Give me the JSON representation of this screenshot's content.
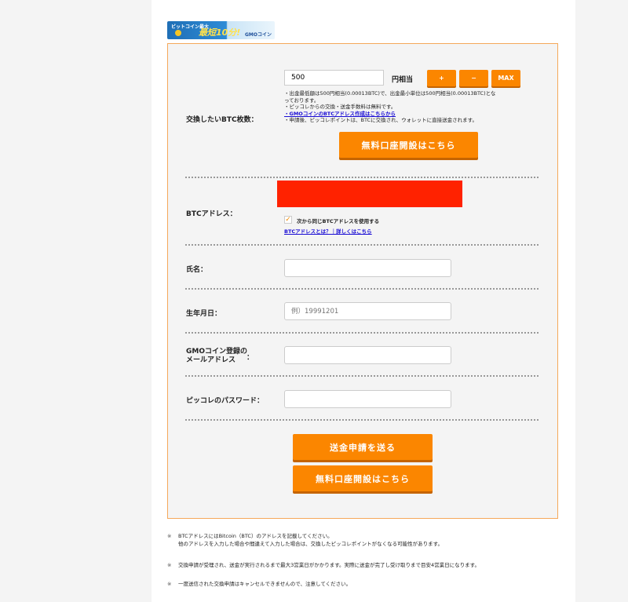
{
  "banner": {
    "line1": "ビットコイン最大",
    "main": "最短10分!",
    "brand": "GMOコイン"
  },
  "form": {
    "btc_amount": {
      "label": "交換したいBTC枚数：",
      "value": "500",
      "unit": "円相当",
      "plus": "+",
      "minus": "−",
      "max": "MAX",
      "notes": [
        "・出金最低額は500円相当(0.00013BTC)で、出金最小単位は500円相当(0.00013BTC)とな",
        "っております。",
        "・ピッコレからの交換・送金手数料は無料です。"
      ],
      "gmo_link": "・GMOコインのBTCアドレス作成はこちらから",
      "note_last": "・申請後、ピッコレポイントは、BTCに交換され、ウォレットに直接送金されます。",
      "open_account": "無料口座開設はこちら"
    },
    "btc_address": {
      "label": "BTCアドレス：",
      "checkbox_label": "次から同じBTCアドレスを使用する",
      "help_link": "BTCアドレスとは？｜詳しくはこちら"
    },
    "name": {
      "label": "氏名：",
      "value": ""
    },
    "birthday": {
      "label": "生年月日：",
      "placeholder": "例）19991201"
    },
    "gmo_email": {
      "label_line1": "GMOコイン登録の",
      "label_line2": "メールアドレス",
      "colon": "：",
      "value": ""
    },
    "password": {
      "label": "ピッコレのパスワード：",
      "value": ""
    },
    "submit": "送金申請を送る",
    "open_account_2": "無料口座開設はこちら"
  },
  "footnotes": [
    {
      "mark": "※",
      "lines": [
        "BTCアドレスにはBitcoin（BTC）のアドレスを記載してください。",
        "他のアドレスを入力した場合や間違えて入力した場合は、交換したピッコレポイントがなくなる可能性があります。"
      ]
    },
    {
      "mark": "※",
      "lines": [
        "交換申請が受理され、送金が実行されるまで最大3営業日がかかります。実際に送金が完了し受け取りまで目安4営業日になります。"
      ]
    },
    {
      "mark": "※",
      "lines": [
        "一度送信された交換申請はキャンセルできませんので、注意してください。"
      ]
    }
  ],
  "colors": {
    "accent": "#fb8600",
    "border": "#f5a85a",
    "link": "#1a0dd4",
    "redacted": "#ff2200"
  }
}
